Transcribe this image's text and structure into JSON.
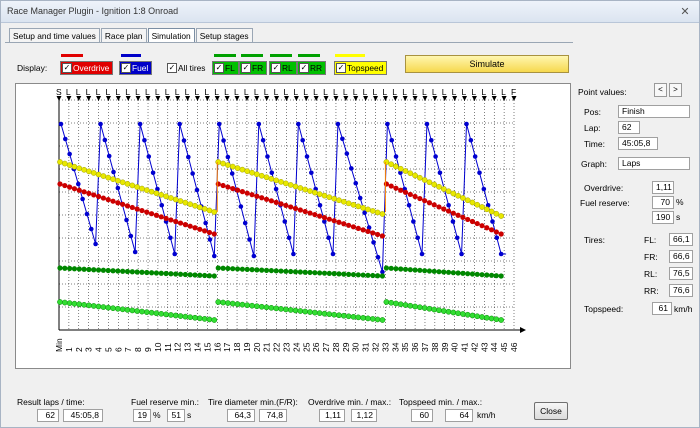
{
  "window": {
    "title": "Race Manager Plugin - Ignition 1:8 Onroad",
    "close_glyph": "✕"
  },
  "tabs": [
    "Setup and time values",
    "Race plan",
    "Simulation",
    "Setup stages"
  ],
  "display": {
    "label": "Display:",
    "checks": [
      {
        "label": "Overdrive",
        "color": "#e00000",
        "checked": true
      },
      {
        "label": "Fuel",
        "color": "#0000c8",
        "checked": true
      },
      {
        "label": "All tires",
        "color": "#f0f0f0",
        "checked": true
      },
      {
        "label": "FL",
        "color": "#00a000",
        "checked": true
      },
      {
        "label": "FR",
        "color": "#00a000",
        "checked": true
      },
      {
        "label": "RL",
        "color": "#00a000",
        "checked": true
      },
      {
        "label": "RR",
        "color": "#00a000",
        "checked": true
      },
      {
        "label": "Topspeed",
        "color": "#ffff00",
        "checked": true
      }
    ],
    "check_glyph": "✓",
    "simulate_label": "Simulate"
  },
  "chart_data": {
    "type": "line",
    "x_tick_labels": [
      "Min",
      "1",
      "2",
      "3",
      "4",
      "5",
      "6",
      "7",
      "8",
      "9",
      "10",
      "11",
      "12",
      "13",
      "14",
      "15",
      "16",
      "17",
      "18",
      "19",
      "20",
      "21",
      "22",
      "23",
      "24",
      "25",
      "26",
      "27",
      "28",
      "29",
      "30",
      "31",
      "32",
      "33",
      "34",
      "35",
      "36",
      "37",
      "38",
      "39",
      "40",
      "41",
      "42",
      "43",
      "44",
      "45",
      "46"
    ],
    "top_markers": [
      "S",
      "L",
      "L",
      "L",
      "L",
      "L",
      "L",
      "L",
      "L",
      "L",
      "L",
      "L",
      "L",
      "L",
      "L",
      "L",
      "L",
      "L",
      "L",
      "L",
      "L",
      "L",
      "L",
      "L",
      "L",
      "L",
      "L",
      "L",
      "L",
      "L",
      "L",
      "L",
      "L",
      "L",
      "L",
      "L",
      "L",
      "L",
      "L",
      "L",
      "L",
      "L",
      "L",
      "L",
      "L",
      "L",
      "F"
    ],
    "pit_laps": [
      4,
      16,
      33
    ],
    "series": [
      {
        "name": "Fuel",
        "color": "#0000d0"
      },
      {
        "name": "Overdrive",
        "color": "#cc0000"
      },
      {
        "name": "Topspeed",
        "color": "#e8e800"
      },
      {
        "name": "Tires",
        "color": "#008800"
      },
      {
        "name": "Tires",
        "color": "#00cc00"
      }
    ]
  },
  "point_values": {
    "header": "Point values:",
    "prev_glyph": "<",
    "next_glyph": ">",
    "pos_label": "Pos:",
    "pos": "Finish",
    "lap_label": "Lap:",
    "lap": "62",
    "time_label": "Time:",
    "time": "45:05,8",
    "graph_label": "Graph:",
    "graph": "Laps",
    "overdrive_label": "Overdrive:",
    "overdrive": "1,11",
    "fuel_label": "Fuel reserve:",
    "fuel_pct": "70",
    "fuel_pct_unit": "%",
    "fuel_s": "190",
    "fuel_s_unit": "s",
    "tires_label": "Tires:",
    "fl_label": "FL:",
    "fl": "66,1",
    "fr_label": "FR:",
    "fr": "66,6",
    "rl_label": "RL:",
    "rl": "76,5",
    "rr_label": "RR:",
    "rr": "76,6",
    "topspeed_label": "Topspeed:",
    "topspeed": "61",
    "topspeed_unit": "km/h"
  },
  "bottom": {
    "result_label": "Result laps / time:",
    "laps": "62",
    "time": "45:05,8",
    "fuel_label": "Fuel reserve min.:",
    "fuel_pct": "19",
    "pct_unit": "%",
    "fuel_s": "51",
    "s_unit": "s",
    "tire_label": "Tire diameter min.(F/R):",
    "tire_f": "64,3",
    "tire_r": "74,8",
    "od_label": "Overdrive min. / max.:",
    "od_min": "1,11",
    "od_max": "1,12",
    "ts_label": "Topspeed min. / max.:",
    "ts_min": "60",
    "ts_max": "64",
    "ts_unit": "km/h",
    "close_label": "Close"
  }
}
